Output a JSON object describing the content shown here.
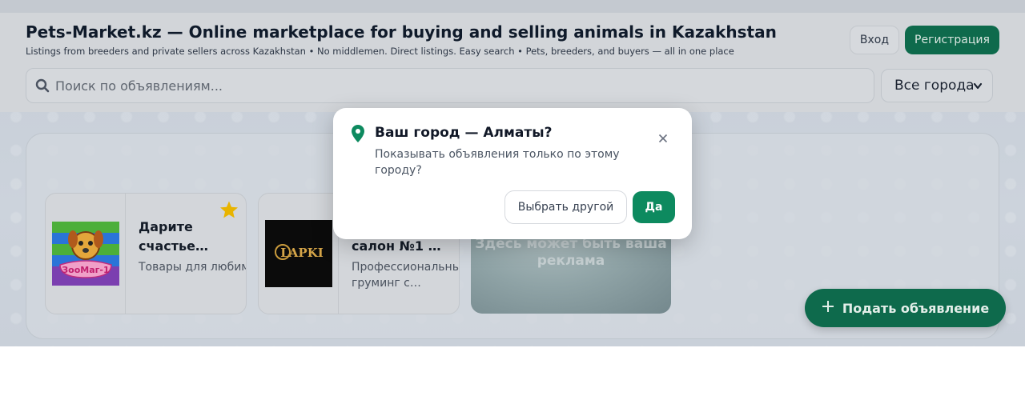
{
  "header": {
    "title": "Pets-Market.kz — Online marketplace for buying and selling animals in Kazakhstan",
    "subtitle": "Listings from breeders and private sellers across Kazakhstan • No middlemen. Direct listings. Easy search • Pets, breeders, and buyers — all in one place",
    "login_label": "Вход",
    "register_label": "Регистрация"
  },
  "search": {
    "placeholder": "Поиск по объявлениям...",
    "icon": "search-icon"
  },
  "city_filter": {
    "selected": "Все города"
  },
  "featured": {
    "cards": [
      {
        "logo_text": "ЗооМаг-1",
        "title": "Дарите счастье…",
        "description": "Товары для любимых…",
        "starred": true
      },
      {
        "logo_text": "LAPKI",
        "title": "салон №1 …",
        "description": "Профессиональный груминг с…",
        "starred": false
      }
    ],
    "ad_text": "Здесь может быть ваша реклама"
  },
  "fab": {
    "label": "Подать объявление"
  },
  "city_modal": {
    "title": "Ваш город — Алматы?",
    "text": "Показывать объявления только по этому городу?",
    "choose_other_label": "Выбрать другой",
    "yes_label": "Да"
  },
  "colors": {
    "brand_green": "#0d8a5f",
    "register_green": "#0e6a4c",
    "star": "#e8b400"
  }
}
